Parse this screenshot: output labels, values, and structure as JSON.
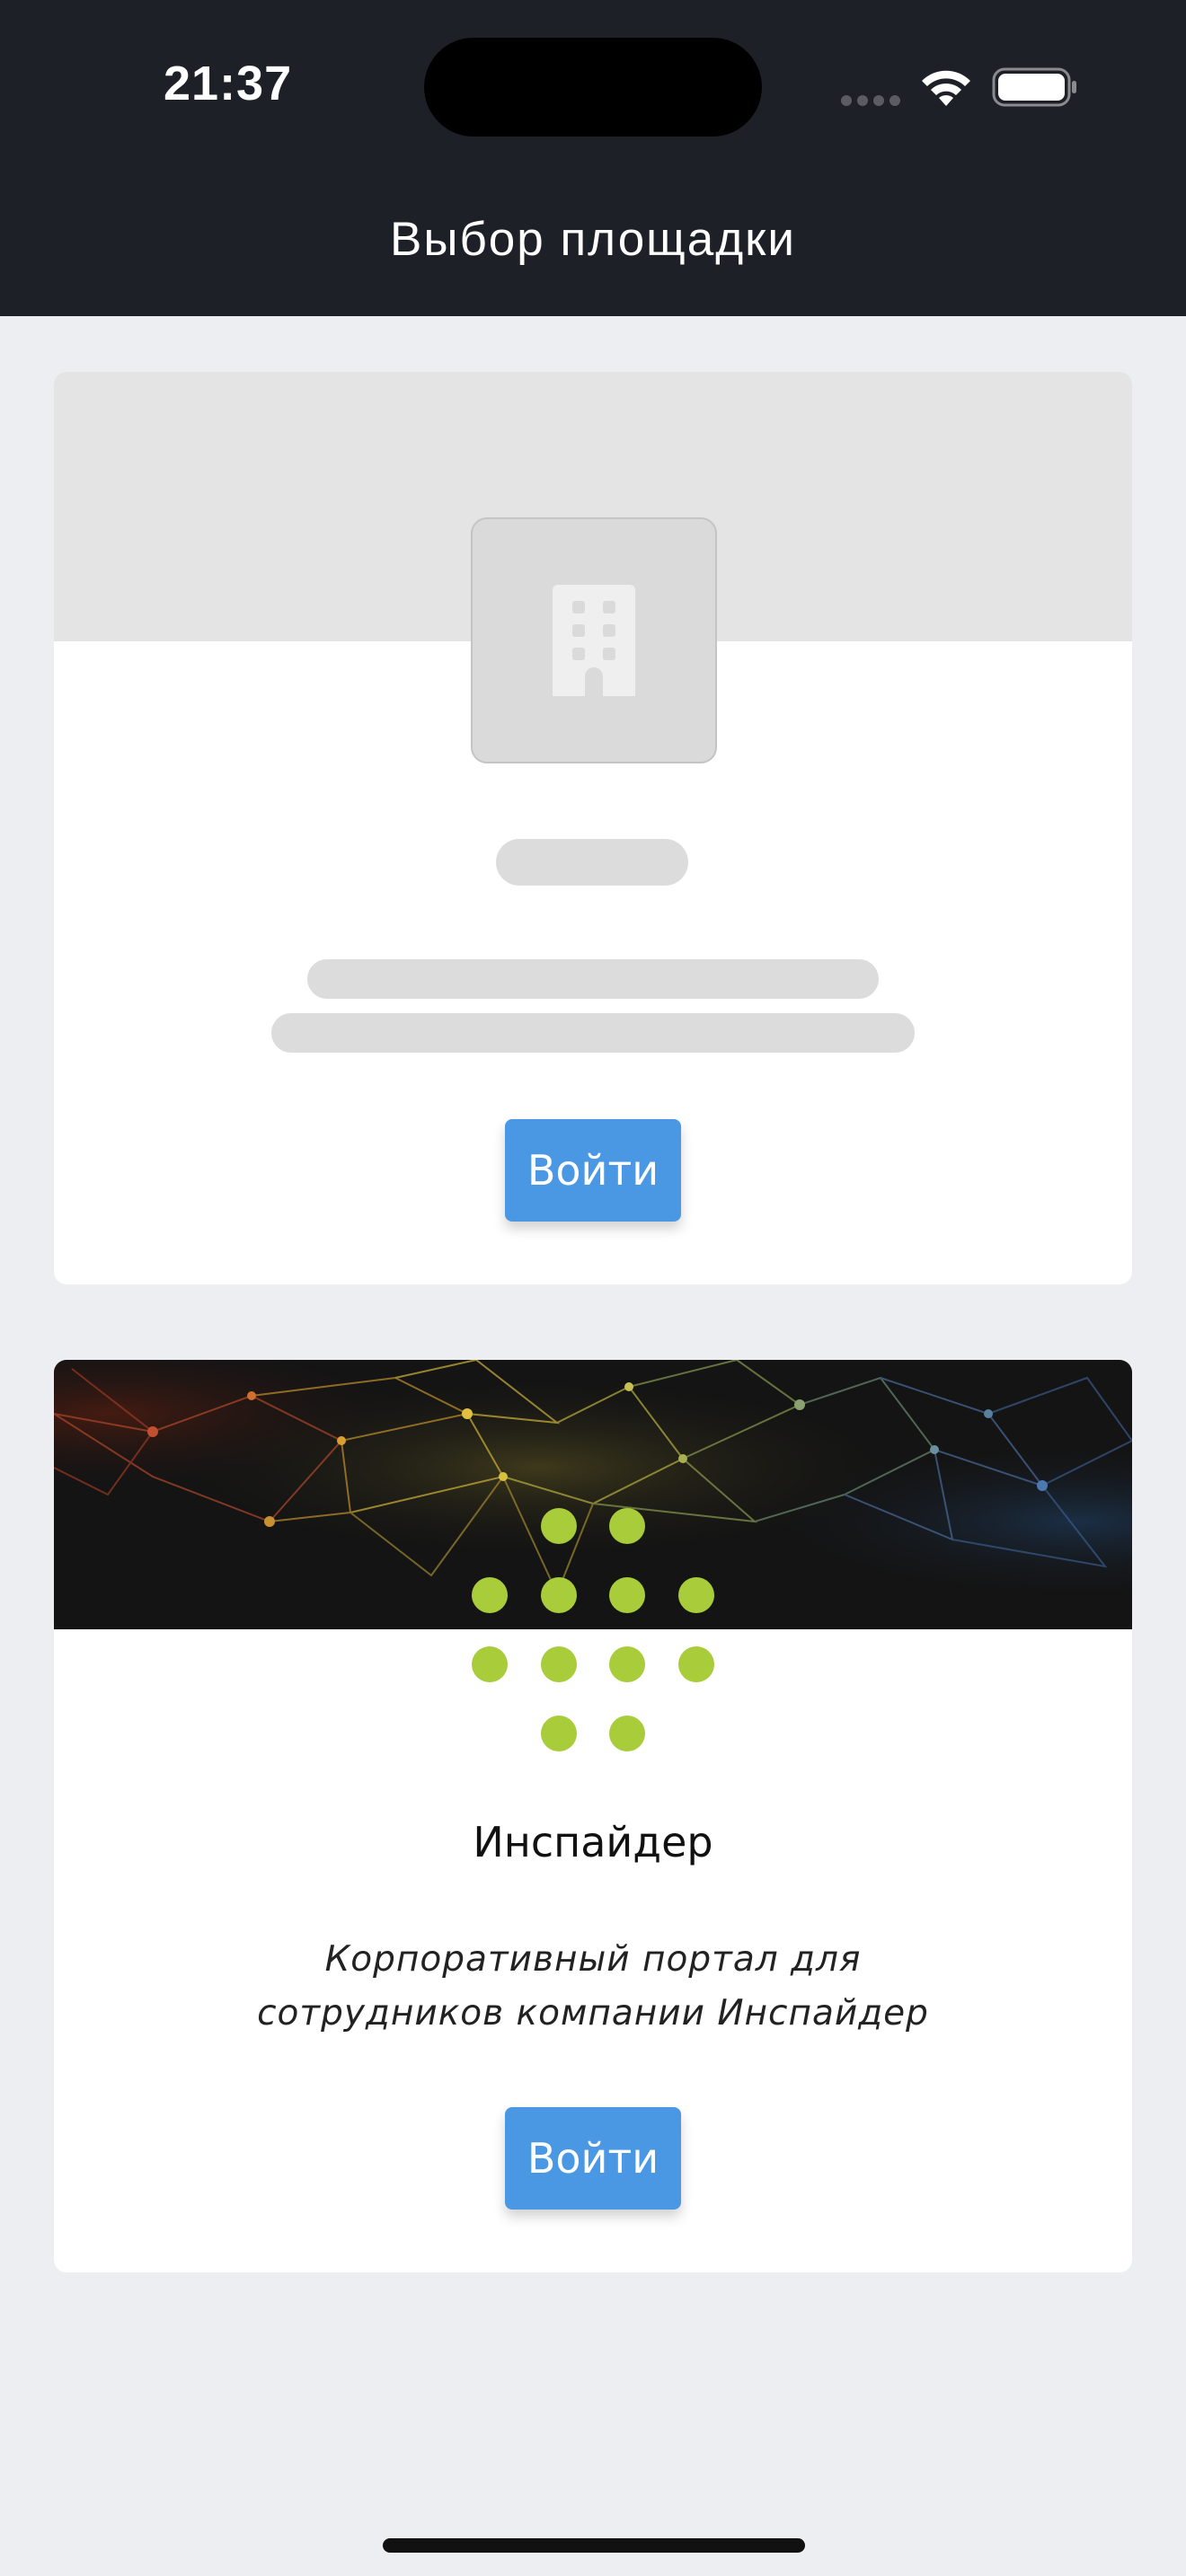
{
  "status_bar": {
    "time": "21:37",
    "icons": [
      "cellular-dots-icon",
      "wifi-icon",
      "battery-icon"
    ]
  },
  "header": {
    "title": "Выбор площадки"
  },
  "sites": [
    {
      "loading": true,
      "login_label": "Войти",
      "logo_icon": "building-icon"
    },
    {
      "loading": false,
      "name": "Инспайдер",
      "description_line1": "Корпоративный портал для",
      "description_line2": "сотрудников компании Инспайдер",
      "login_label": "Войти",
      "logo_icon": "dots-logo-icon"
    }
  ],
  "colors": {
    "header_bg": "#1e2027",
    "page_bg": "#eceef2",
    "button_bg": "#4a98e4",
    "logo_dot": "#a8cc3a"
  }
}
